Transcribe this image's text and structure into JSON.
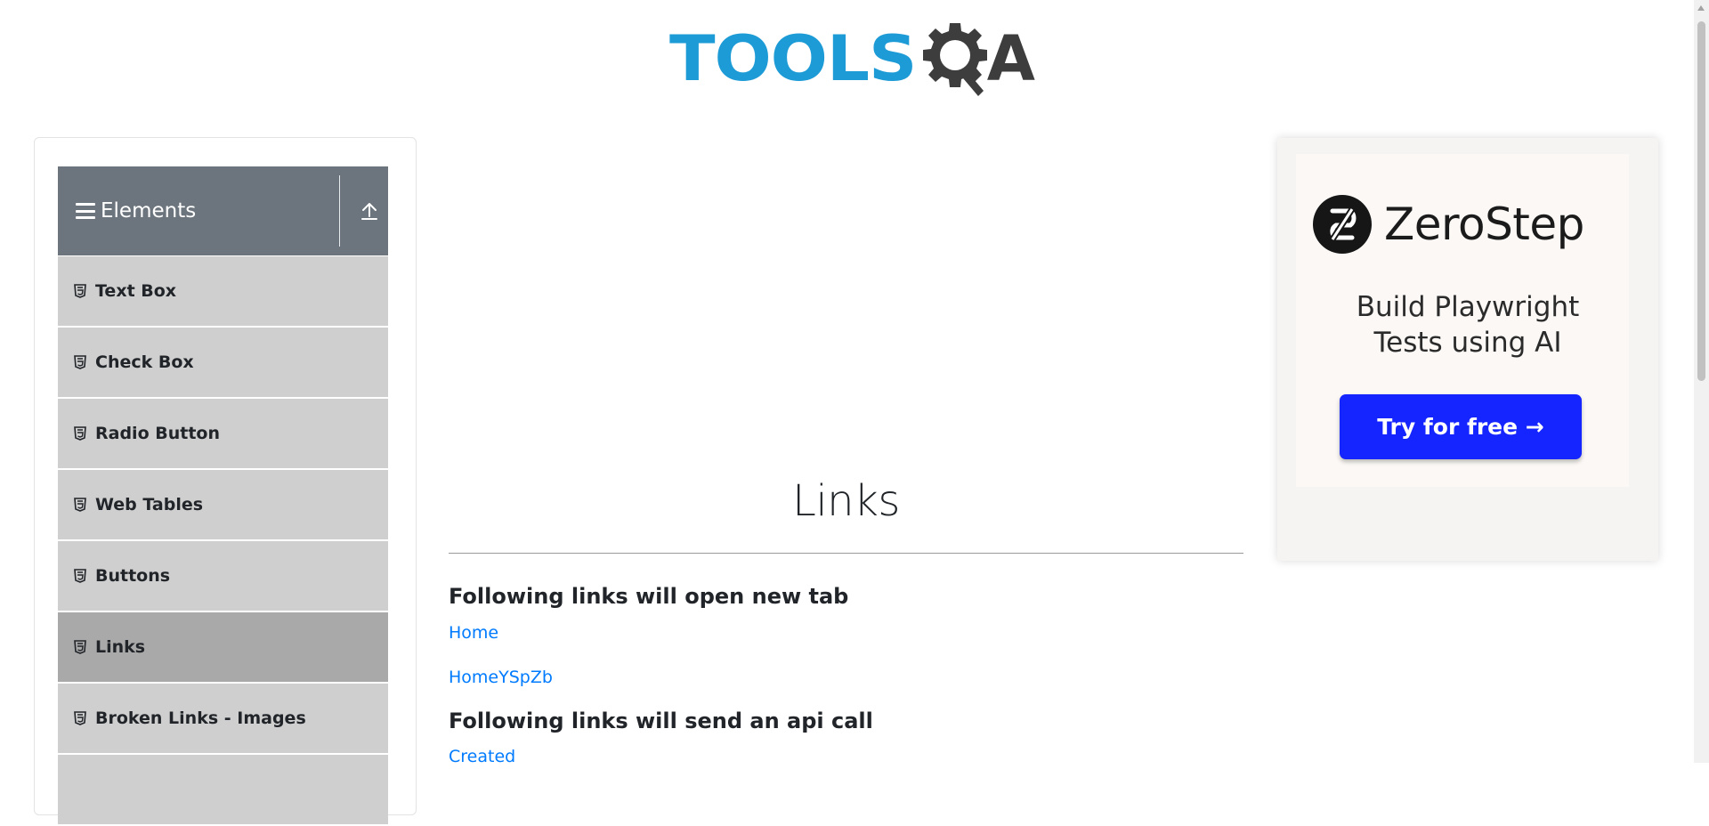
{
  "header": {
    "logo_text_left": "TOOLS",
    "logo_text_right": "A",
    "logo_colors": {
      "tools": "#1d9bd6",
      "qa": "#3d3d3d"
    }
  },
  "sidebar": {
    "group_title": "Elements",
    "group_header_color": "#6c757d",
    "items": [
      {
        "label": "Text Box",
        "icon": "html5-icon",
        "active": false
      },
      {
        "label": "Check Box",
        "icon": "html5-icon",
        "active": false
      },
      {
        "label": "Radio Button",
        "icon": "html5-icon",
        "active": false
      },
      {
        "label": "Web Tables",
        "icon": "html5-icon",
        "active": false
      },
      {
        "label": "Buttons",
        "icon": "html5-icon",
        "active": false
      },
      {
        "label": "Links",
        "icon": "html5-icon",
        "active": true
      },
      {
        "label": "Broken Links - Images",
        "icon": "html5-icon",
        "active": false
      }
    ]
  },
  "main": {
    "title": "Links",
    "sections": [
      {
        "heading": "Following links will open new tab",
        "links": [
          "Home",
          "HomeYSpZb"
        ]
      },
      {
        "heading": "Following links will send an api call",
        "links": [
          "Created"
        ]
      }
    ],
    "link_color": "#007bff"
  },
  "ad": {
    "brand": "ZeroStep",
    "tagline_line1": "Build Playwright",
    "tagline_line2": "Tests using AI",
    "cta": "Try for free →",
    "cta_color": "#1525ff"
  }
}
